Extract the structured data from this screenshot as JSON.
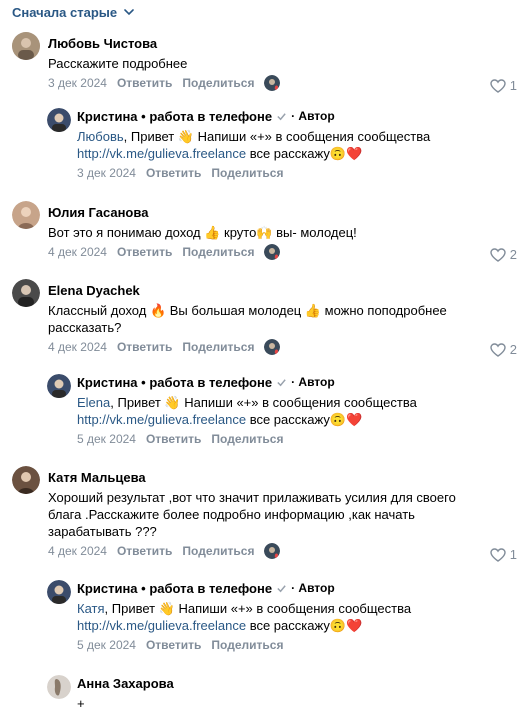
{
  "sort": {
    "label": "Сначала старые"
  },
  "actions": {
    "reply": "Ответить",
    "share": "Поделиться",
    "author_badge": "· Автор"
  },
  "comments": [
    {
      "author": "Любовь Чистова",
      "text": "Расскажите подробнее",
      "date": "3 дек 2024",
      "likes": "1"
    },
    {
      "author": "Кристина • работа в телефоне",
      "mention": "Любовь",
      "text_a": ", Привет 👋 Напиши «+» в сообщения сообщества",
      "link": "http://vk.me/gulieva.freelance",
      "text_b": " все расскажу🙃❤️",
      "date": "3 дек 2024"
    },
    {
      "author": "Юлия Гасанова",
      "text": "Вот это я понимаю доход 👍 круто🙌 вы- молодец!",
      "date": "4 дек 2024",
      "likes": "2"
    },
    {
      "author": "Elena Dyachek",
      "text": "Классный доход 🔥 Вы большая молодец 👍 можно поподробнее рассказать?",
      "date": "4 дек 2024",
      "likes": "2"
    },
    {
      "author": "Кристина • работа в телефоне",
      "mention": "Elena",
      "text_a": ", Привет 👋 Напиши «+» в сообщения сообщества",
      "link": "http://vk.me/gulieva.freelance",
      "text_b": " все расскажу🙃❤️",
      "date": "5 дек 2024"
    },
    {
      "author": "Катя Мальцева",
      "text": "Хороший результат ,вот что значит прилаживать усилия для своего блага .Расскажите более подробно информацию ,как начать зарабатывать ???",
      "date": "4 дек 2024",
      "likes": "1"
    },
    {
      "author": "Кристина • работа в телефоне",
      "mention": "Катя",
      "text_a": ", Привет 👋 Напиши «+» в сообщения сообщества",
      "link": "http://vk.me/gulieva.freelance",
      "text_b": " все расскажу🙃❤️",
      "date": "5 дек 2024"
    },
    {
      "author": "Анна Захарова",
      "text": "+"
    }
  ]
}
